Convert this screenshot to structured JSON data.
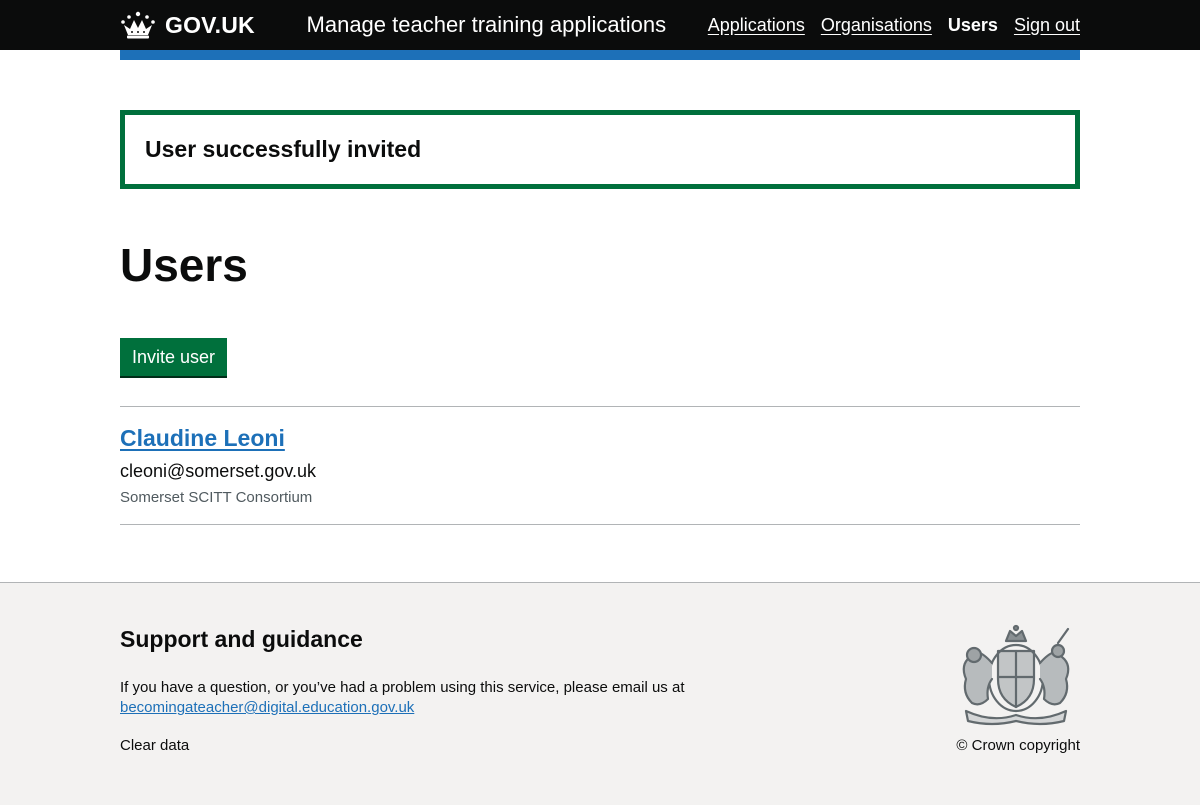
{
  "header": {
    "logo_text": "GOV.UK",
    "service_name": "Manage teacher training applications",
    "nav": [
      {
        "label": "Applications",
        "active": false
      },
      {
        "label": "Organisations",
        "active": false
      },
      {
        "label": "Users",
        "active": true
      },
      {
        "label": "Sign out",
        "active": false
      }
    ]
  },
  "banner": {
    "message": "User successfully invited"
  },
  "main": {
    "title": "Users",
    "invite_button_label": "Invite user",
    "users": [
      {
        "name": "Claudine Leoni",
        "email": "cleoni@somerset.gov.uk",
        "organisation": "Somerset SCITT Consortium"
      }
    ]
  },
  "footer": {
    "heading": "Support and guidance",
    "text": "If you have a question, or you’ve had a problem using this service, please email us at",
    "email": "becomingateacher@digital.education.gov.uk",
    "clear_data_label": "Clear data",
    "copyright": "© Crown copyright"
  },
  "colors": {
    "header_bg": "#0b0c0c",
    "brand_blue": "#1d70b8",
    "success_green": "#00703c",
    "footer_bg": "#f3f2f1",
    "secondary_text": "#505a5f"
  },
  "icons": {
    "logo": "crown-icon",
    "footer_crest": "royal-coat-of-arms-icon"
  }
}
